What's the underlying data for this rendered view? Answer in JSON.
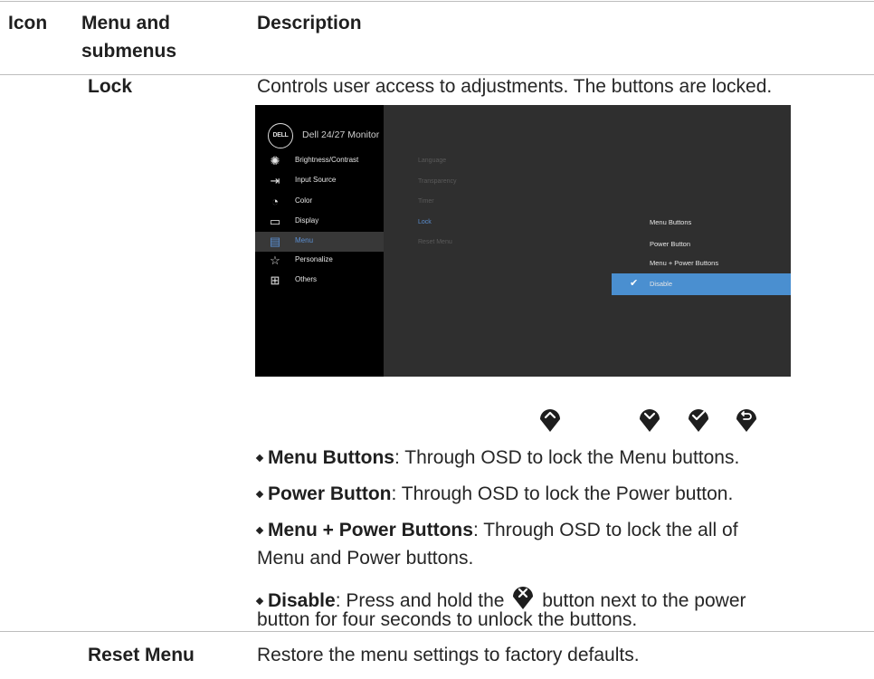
{
  "table": {
    "headers": {
      "icon": "Icon",
      "menu_line1": "Menu and",
      "menu_line2": "submenus",
      "description": "Description"
    },
    "lock_row": {
      "label": "Lock",
      "description": "Controls user access to adjustments. The buttons are locked."
    },
    "reset_row": {
      "label": "Reset Menu",
      "description": "Restore the menu settings to factory defaults."
    }
  },
  "osd": {
    "logo_text": "DELL",
    "title": "Dell 24/27 Monitor",
    "left_menu": [
      {
        "label": "Brightness/Contrast",
        "icon": "brightness-icon"
      },
      {
        "label": "Input Source",
        "icon": "input-source-icon"
      },
      {
        "label": "Color",
        "icon": "color-icon"
      },
      {
        "label": "Display",
        "icon": "display-icon"
      },
      {
        "label": "Menu",
        "icon": "menu-icon",
        "active": true
      },
      {
        "label": "Personalize",
        "icon": "star-icon"
      },
      {
        "label": "Others",
        "icon": "others-icon"
      }
    ],
    "submenu": [
      "Language",
      "Transparency",
      "Timer",
      "Lock",
      "Reset Menu"
    ],
    "options_header": "Menu Buttons",
    "options": [
      "Power Button",
      "Menu + Power Buttons",
      "Disable"
    ],
    "selected_option": "Disable",
    "colors": {
      "accent": "#4a8fd0",
      "panel": "#2f2f2f",
      "sidebar": "#000000"
    }
  },
  "joystick_icons": [
    "up-icon",
    "down-icon",
    "check-icon",
    "back-icon"
  ],
  "bullets": [
    {
      "term": "Menu Buttons",
      "text": ": Through OSD to lock the Menu buttons."
    },
    {
      "term": "Power Button",
      "text": ": Through OSD to lock the Power button."
    },
    {
      "term": "Menu + Power Buttons",
      "text": ": Through OSD to lock the all of",
      "cont": "Menu and Power buttons."
    },
    {
      "term": "Disable",
      "text_before": ": Press and hold the",
      "text_after": "button next to the power",
      "cont": "button for four seconds to unlock the buttons."
    }
  ]
}
